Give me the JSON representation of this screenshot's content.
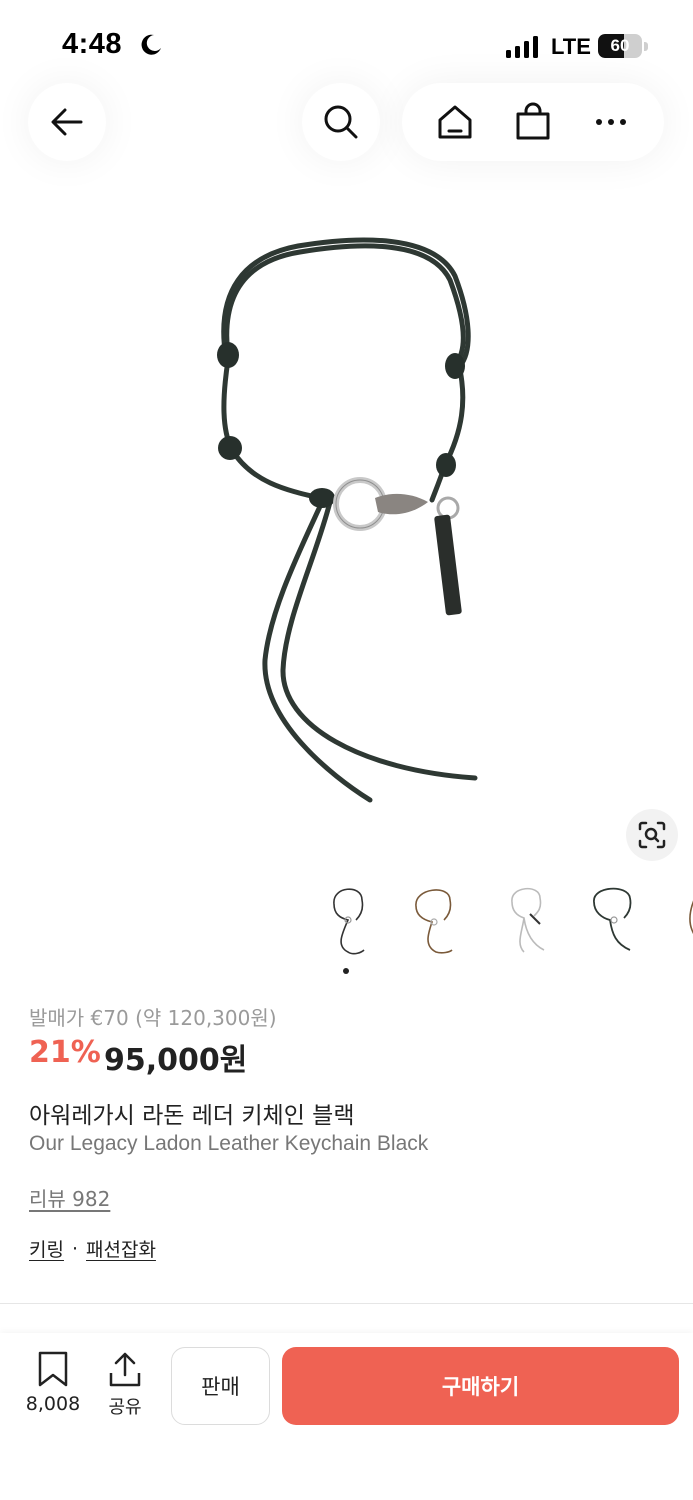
{
  "status_bar": {
    "time": "4:48",
    "network": "LTE",
    "battery": "60",
    "battery_level": 0.6,
    "icons": [
      "moon-icon",
      "signal-icon",
      "battery-icon"
    ]
  },
  "nav": {
    "icons": [
      "back-arrow-icon",
      "search-icon",
      "home-icon",
      "shopping-bag-icon",
      "more-icon"
    ]
  },
  "gallery": {
    "thumbnail_count": 5,
    "active_index": 0,
    "icons": [
      "lens-search-icon"
    ]
  },
  "product": {
    "original_price": "발매가 €70 (약 120,300원)",
    "discount": "21%",
    "sale_price": "95,000원",
    "title_ko": "아워레가시 라돈 레더 키체인 블랙",
    "title_en": "Our Legacy Ladon Leather Keychain Black",
    "review": "리뷰 982",
    "categories": [
      "키링",
      "패션잡화"
    ],
    "category_separator": "·"
  },
  "bottom_bar": {
    "bookmark_count": "8,008",
    "share_label": "공유",
    "sell_label": "판매",
    "buy_label": "구매하기"
  },
  "colors": {
    "accent": "#ef6253",
    "text": "#222222",
    "muted": "#9a9a9a"
  }
}
